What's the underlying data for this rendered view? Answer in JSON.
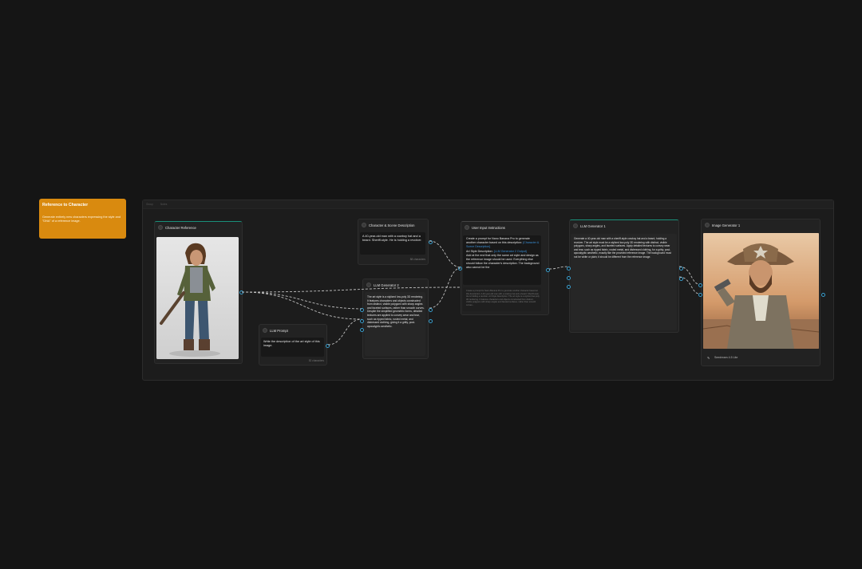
{
  "note": {
    "title": "Reference to Character",
    "description": "Generate entirely new characters expressing the style and \"DNA\" of a reference image."
  },
  "group": {
    "label": "Group",
    "sub": "Notes"
  },
  "nodes": {
    "character_reference": {
      "title": "Character Reference"
    },
    "llm_prompt": {
      "title": "LLM Prompt",
      "text": "Write the description of the art style of this image.",
      "chars": "52 characters"
    },
    "character_scene": {
      "title": "Character & Scene Description",
      "text": "A 40-year-old man with a cowboy hat and a beard. Sheriff-style. He is holding a revolver.",
      "chars": "88 characters"
    },
    "llm_generator_2": {
      "title": "LLM Generator 2",
      "output": "The art style is a stylized low-poly 3D rendering. It features characters and objects constructed from distinct, visible polygons with sharp angles and faceted surfaces, rather than smooth curves. Despite the simplified geometric forms, detailed textures are applied to convey wear and tear, such as ripped fabric, rusted metal, and distressed clothing, giving it a gritty, post-apocalyptic aesthetic."
    },
    "user_input": {
      "title": "User Input Instructions",
      "text_a": "Create a prompt for Nano Banana Pro to generate another character based on this description: ",
      "link_a": "{Character & Scene Description}",
      "text_b": "Art Style Description: ",
      "link_b": "{LLM Generator 2 Output}",
      "text_c": "Add at the end that only the same art style and design as the reference image should be used. Everything else should follow the character's description. The background also cannot be the",
      "preview": "Create a prompt for Nano Banana Pro to generate another character based on this description: A 40-year-old man with a cowboy hat and a beard. Sheriff-style. He is holding a revolver. Art Style Description: The art style is a stylized low-poly 3D rendering. It features characters and objects constructed from distinct, visible polygons with sharp angles and faceted surfaces, rather than smooth curves..."
    },
    "llm_generator_1": {
      "title": "LLM Generator 1",
      "output": "Generate a 40-year-old man with a sheriff-style cowboy hat and a beard, holding a revolver. The art style must be a stylized low-poly 3D rendering with distinct, visible polygons, sharp angles, and faceted surfaces. Apply detailed textures to convey wear and tear, such as ripped fabric, rusted metal, and distressed clothing, for a gritty, post-apocalyptic aesthetic, exactly like the provided reference image. The background must not be white or plain; it should be different from the reference image."
    },
    "image_generator_1": {
      "title": "Image Generator 1",
      "model": "Seedream 4.5 Lite"
    }
  },
  "colors": {
    "note": "#d98a0f",
    "port": "#3aa0d0",
    "accent": "#1a8f7a",
    "canvas": "#151515"
  }
}
